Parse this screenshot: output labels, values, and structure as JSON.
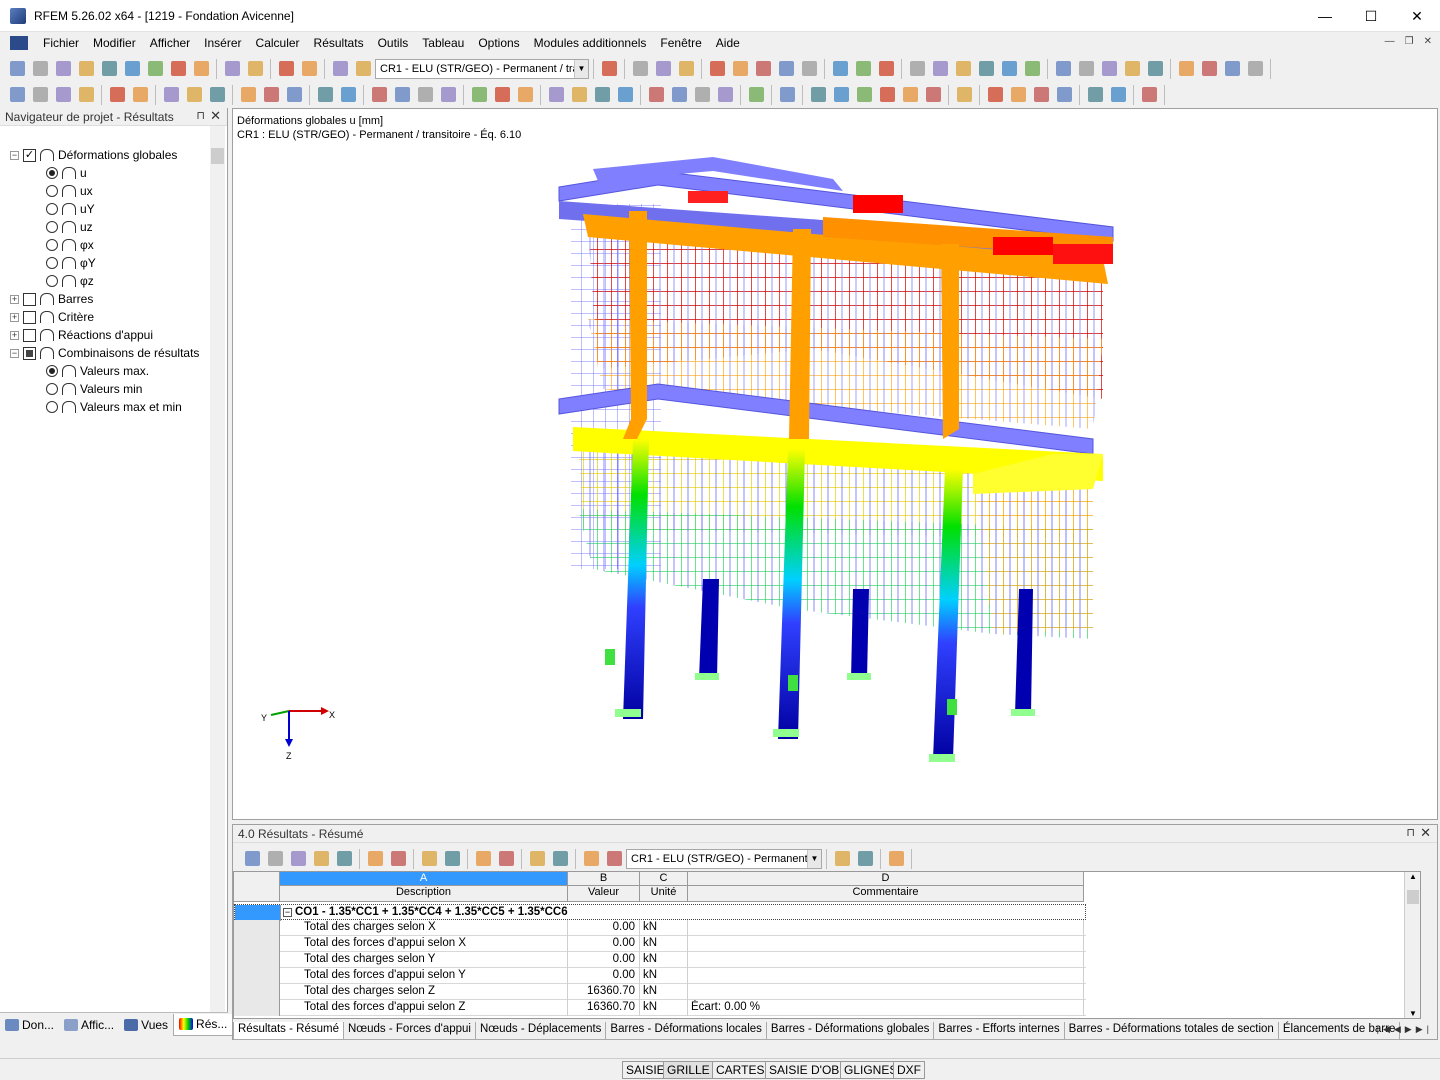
{
  "window": {
    "title": "RFEM 5.26.02 x64 - [1219 - Fondation Avicenne]",
    "minimize": "—",
    "maximize": "☐",
    "close": "✕"
  },
  "menu": [
    "Fichier",
    "Modifier",
    "Afficher",
    "Insérer",
    "Calculer",
    "Résultats",
    "Outils",
    "Tableau",
    "Options",
    "Modules additionnels",
    "Fenêtre",
    "Aide"
  ],
  "toolbar": {
    "loadcase_combo": "CR1 - ELU (STR/GEO) - Permanent / trar"
  },
  "navigator": {
    "title": "Navigateur de projet - Résultats",
    "items": [
      {
        "label": "Déformations globales",
        "kind": "check",
        "checked": true,
        "expanded": true,
        "level": 0
      },
      {
        "label": "u",
        "kind": "radio",
        "on": true,
        "level": 1
      },
      {
        "label": "ux",
        "kind": "radio",
        "on": false,
        "level": 1
      },
      {
        "label": "uY",
        "kind": "radio",
        "on": false,
        "level": 1
      },
      {
        "label": "uz",
        "kind": "radio",
        "on": false,
        "level": 1
      },
      {
        "label": "φx",
        "kind": "radio",
        "on": false,
        "level": 1
      },
      {
        "label": "φY",
        "kind": "radio",
        "on": false,
        "level": 1
      },
      {
        "label": "φz",
        "kind": "radio",
        "on": false,
        "level": 1
      },
      {
        "label": "Barres",
        "kind": "check",
        "checked": false,
        "expanded": false,
        "level": 0
      },
      {
        "label": "Critère",
        "kind": "check",
        "checked": false,
        "expanded": false,
        "level": 0
      },
      {
        "label": "Réactions d'appui",
        "kind": "check",
        "checked": false,
        "expanded": false,
        "level": 0
      },
      {
        "label": "Combinaisons de résultats",
        "kind": "check",
        "checked": "partial",
        "expanded": true,
        "level": 0
      },
      {
        "label": "Valeurs max.",
        "kind": "radio",
        "on": true,
        "level": 1
      },
      {
        "label": "Valeurs min",
        "kind": "radio",
        "on": false,
        "level": 1
      },
      {
        "label": "Valeurs max et min",
        "kind": "radio",
        "on": false,
        "level": 1
      }
    ],
    "tabs": [
      "Don...",
      "Affic...",
      "Vues",
      "Rés..."
    ]
  },
  "view": {
    "caption1": "Déformations globales u [mm]",
    "caption2": "CR1 : ELU (STR/GEO) - Permanent / transitoire - Éq. 6.10",
    "axes": {
      "x": "X",
      "y": "Y",
      "z": "Z"
    }
  },
  "results": {
    "title": "4.0 Résultats - Résumé",
    "combo": "CR1 - ELU (STR/GEO) - Permanent /",
    "col_letters": [
      "A",
      "B",
      "C",
      "D"
    ],
    "col_headers": [
      "Description",
      "Valeur",
      "Unité",
      "Commentaire"
    ],
    "group": "CO1 - 1.35*CC1 + 1.35*CC4 + 1.35*CC5 + 1.35*CC6",
    "rows": [
      {
        "desc": "Total des charges selon X",
        "value": "0.00",
        "unit": "kN",
        "comment": ""
      },
      {
        "desc": "Total des forces d'appui selon X",
        "value": "0.00",
        "unit": "kN",
        "comment": ""
      },
      {
        "desc": "Total des charges selon Y",
        "value": "0.00",
        "unit": "kN",
        "comment": ""
      },
      {
        "desc": "Total des forces d'appui selon Y",
        "value": "0.00",
        "unit": "kN",
        "comment": ""
      },
      {
        "desc": "Total des charges selon Z",
        "value": "16360.70",
        "unit": "kN",
        "comment": ""
      },
      {
        "desc": "Total des forces d'appui selon Z",
        "value": "16360.70",
        "unit": "kN",
        "comment": "Écart:  0.00 %"
      }
    ],
    "tabs": [
      "Résultats - Résumé",
      "Nœuds - Forces d'appui",
      "Nœuds - Déplacements",
      "Barres - Déformations locales",
      "Barres - Déformations globales",
      "Barres - Efforts internes",
      "Barres - Déformations totales de section",
      "Élancements de barre"
    ]
  },
  "status": [
    "SAISIE",
    "GRILLE",
    "CARTES",
    "SAISIE D'OB.",
    "GLIGNES",
    "DXF"
  ],
  "colors": {
    "accent": "#3399ff",
    "blue": "#0000a0",
    "red": "#ff0000",
    "yellow": "#ffff00",
    "orange": "#ffa000",
    "green": "#00e000",
    "member": "#7f7fff"
  }
}
